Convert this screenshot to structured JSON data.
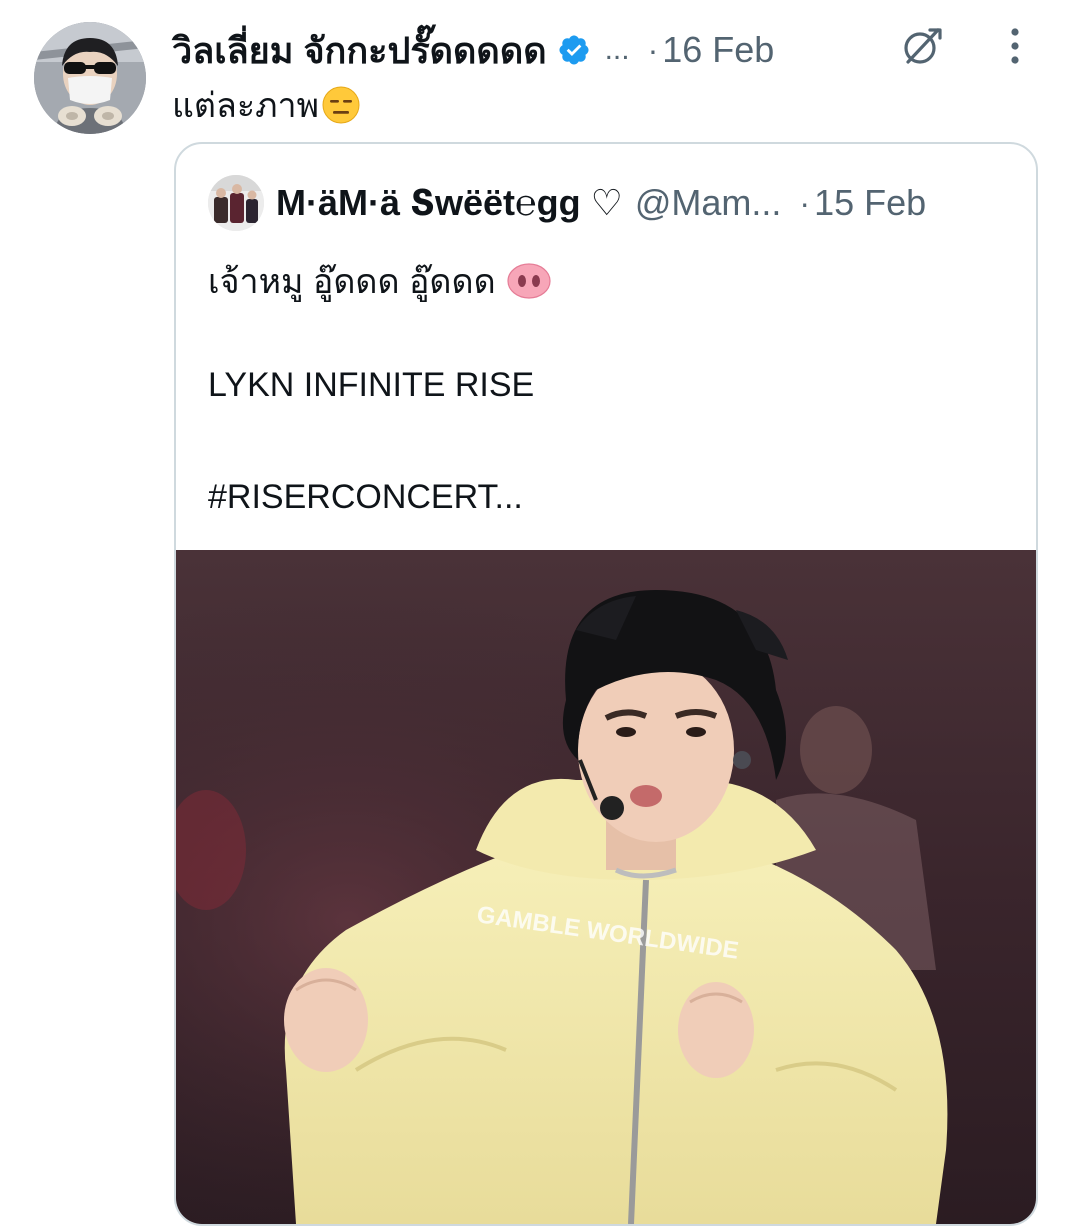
{
  "tweet": {
    "author_name": "วิลเลี่ยม จักกะปรั๊ดดดดด",
    "handle_truncated": "...",
    "separator": "·",
    "timestamp": "16 Feb",
    "text": "แต่ละภาพ",
    "text_emoji": "expressionless-face"
  },
  "icons": {
    "verified": "verified-badge-icon",
    "grok": "grok-icon",
    "more": "more-options-icon"
  },
  "colors": {
    "verified_blue": "#1d9bf0",
    "secondary_text": "#536471",
    "border": "#cfd9de"
  },
  "quote": {
    "author_name": "M·äM·ä Տwëët℮gg ♡",
    "handle": "@Mam...",
    "separator": "·",
    "timestamp": "15 Feb",
    "line1": "เจ้าหมู อู๊ดดด อู๊ดดด",
    "line1_emoji": "pig-nose",
    "line2": "LYKN INFINITE RISE",
    "line3": "#RISERCONCERT...",
    "hoodie_print": "GAMBLE WORLDWIDE"
  }
}
